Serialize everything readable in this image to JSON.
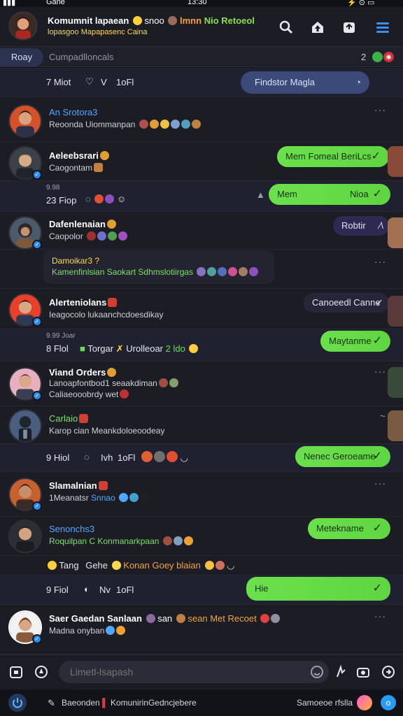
{
  "status_bar": {
    "carrier": "Gane",
    "time": "13:30"
  },
  "header": {
    "title_a": "Komumnit lapaean",
    "title_b": "snoo",
    "title_c": "lmnn",
    "title_d": "Nio Retoeol",
    "subtitle": "lopasgoo Mapapasenc Caina",
    "icons": [
      "search-icon",
      "upload-icon",
      "inbox-icon",
      "menu-icon"
    ]
  },
  "filter": {
    "today_label": "Roay",
    "label": "Cumpadlloncals",
    "count": "2"
  },
  "rows": [
    {
      "meta": "7 Miot",
      "meta2": "V",
      "meta3": "1oFl",
      "pill": "Findstor Magla"
    },
    {
      "name": "An Srotora3",
      "sub": "Reoonda Uiommanpan"
    },
    {
      "name": "Aeleebsrari",
      "sub": "Caogontam",
      "pill": "Mem Fomeal BeriLcs"
    },
    {
      "meta_top": "9.98",
      "meta": "23 Fiop",
      "pill": "Mem",
      "pill_right": "Nioa"
    },
    {
      "name": "Dafenlenaian",
      "sub": "Caopolor",
      "pill": "Robtir"
    },
    {
      "quote1": "Damoikar3 ?",
      "quote2": "Kamenfinlsian Saokart Sdhmslotiirgas"
    },
    {
      "name": "Alerteniolans",
      "sub": "Ieagocolo lukaanchcdoesdikay",
      "pill": "Canoeedl Canne"
    },
    {
      "meta_top": "9.99 Joar",
      "meta": "8 Flol",
      "meta2": "Torgar",
      "meta3": "Urolleoar",
      "meta4": "2 ldo",
      "pill": "Maytanme"
    },
    {
      "name": "Viand Orders",
      "sub": "Lanoapfontbod1 seaakdiman",
      "sub2": "Caliaeooobrdy wet"
    },
    {
      "name": "Carlaio",
      "sub": "Karop cian Meankdoloeoodeay"
    },
    {
      "meta": "9 Hiol",
      "meta2": "Ivh",
      "meta3": "1oFl",
      "pill": "Nenec Geroeame"
    },
    {
      "name": "Slamalnian",
      "sub": "1Meanatsr",
      "sub_b": "Snnao"
    },
    {
      "name": "Senonchs3",
      "sub": "Roquilpan C Konmanarkpaan",
      "pill": "Metekname"
    },
    {
      "meta": "Tang",
      "meta2": "Gehe",
      "meta3": "Konan Goey blaian"
    },
    {
      "meta": "9 Fiol",
      "meta2": "Nv",
      "meta3": "1oFl",
      "pill": "Hie"
    },
    {
      "name": "Saer Gaedan Sanlaan",
      "name_b": "san",
      "name_c": "sean Met Recoet",
      "sub": "Madna onyban"
    }
  ],
  "composer": {
    "placeholder": "Limetl-lsapash"
  },
  "footer": {
    "left": "Baeonden",
    "mid": "KomunirinGedncjebere",
    "right": "Samoeoe rfslla"
  },
  "colors": {
    "accent_green": "#6be04c",
    "accent_blue": "#2a8bf2",
    "bg": "#15161c"
  }
}
